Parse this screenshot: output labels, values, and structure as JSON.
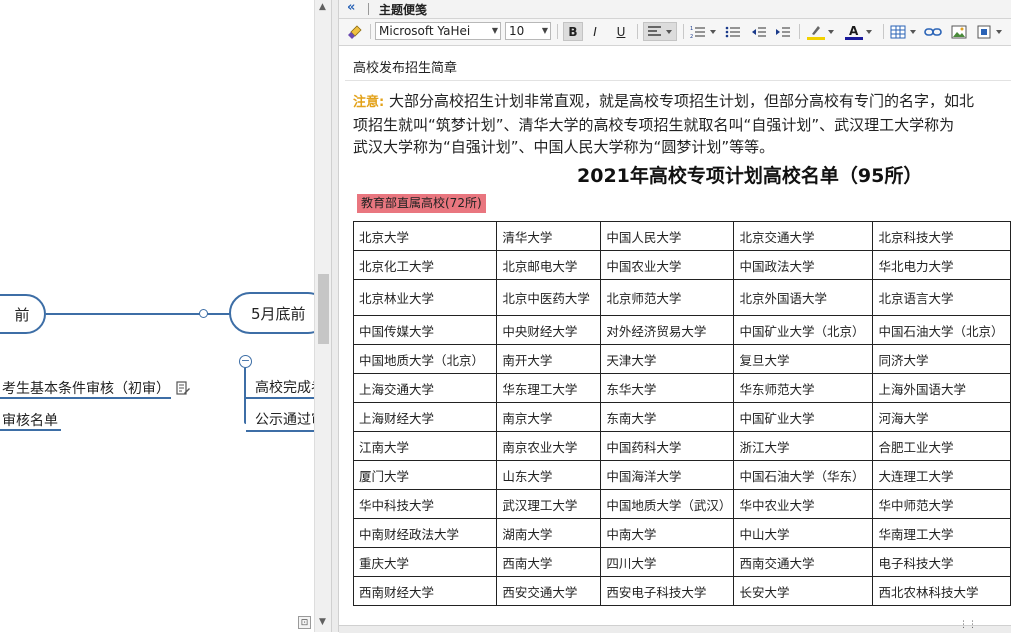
{
  "mindmap": {
    "node_left": "前",
    "node_center": "5月底前",
    "left_subtopics": [
      "考生基本条件审核（初审）",
      "审核名单"
    ],
    "center_subtopics": [
      "高校完成考",
      "公示通过审"
    ],
    "collapse_symbol": "−"
  },
  "panel": {
    "collapse_symbol": "«",
    "title": "主题便笺"
  },
  "toolbar": {
    "font_name": "Microsoft YaHei",
    "font_size": "10",
    "bold": "B",
    "italic": "I",
    "underline": "U",
    "highlight_color": "#f2d100",
    "font_color": "#1a1a9c"
  },
  "document": {
    "title": "高校发布招生简章",
    "note_label": "注意:",
    "note_lines": [
      "大部分高校招生计划非常直观，就是高校专项招生计划，但部分高校有专门的名字，如北",
      "项招生就叫“筑梦计划”、清华大学的高校专项招生就取名叫“自强计划”、武汉理工大学称为",
      "武汉大学称为“自强计划”、中国人民大学称为“圆梦计划”等等。"
    ],
    "heading": "2021年高校专项计划高校名单（95所）",
    "category": "教育部直属高校(72所)",
    "table_rows": [
      [
        "北京大学",
        "清华大学",
        "中国人民大学",
        "北京交通大学",
        "北京科技大学"
      ],
      [
        "北京化工大学",
        "北京邮电大学",
        "中国农业大学",
        "中国政法大学",
        "华北电力大学"
      ],
      [
        "北京林业大学",
        "北京中医药大学",
        "北京师范大学",
        "北京外国语大学",
        "北京语言大学"
      ],
      [
        "中国传媒大学",
        "中央财经大学",
        "对外经济贸易大学",
        "中国矿业大学（北京）",
        "中国石油大学（北京）"
      ],
      [
        "中国地质大学（北京）",
        "南开大学",
        "天津大学",
        "复旦大学",
        "同济大学"
      ],
      [
        "上海交通大学",
        "华东理工大学",
        "东华大学",
        "华东师范大学",
        "上海外国语大学"
      ],
      [
        "上海财经大学",
        "南京大学",
        "东南大学",
        "中国矿业大学",
        "河海大学"
      ],
      [
        "江南大学",
        "南京农业大学",
        "中国药科大学",
        "浙江大学",
        "合肥工业大学"
      ],
      [
        "厦门大学",
        "山东大学",
        "中国海洋大学",
        "中国石油大学（华东）",
        "大连理工大学"
      ],
      [
        "华中科技大学",
        "武汉理工大学",
        "中国地质大学（武汉）",
        "华中农业大学",
        "华中师范大学"
      ],
      [
        "中南财经政法大学",
        "湖南大学",
        "中南大学",
        "中山大学",
        "华南理工大学"
      ],
      [
        "重庆大学",
        "西南大学",
        "四川大学",
        "西南交通大学",
        "电子科技大学"
      ],
      [
        "西南财经大学",
        "西安交通大学",
        "西安电子科技大学",
        "长安大学",
        "西北农林科技大学"
      ]
    ]
  }
}
